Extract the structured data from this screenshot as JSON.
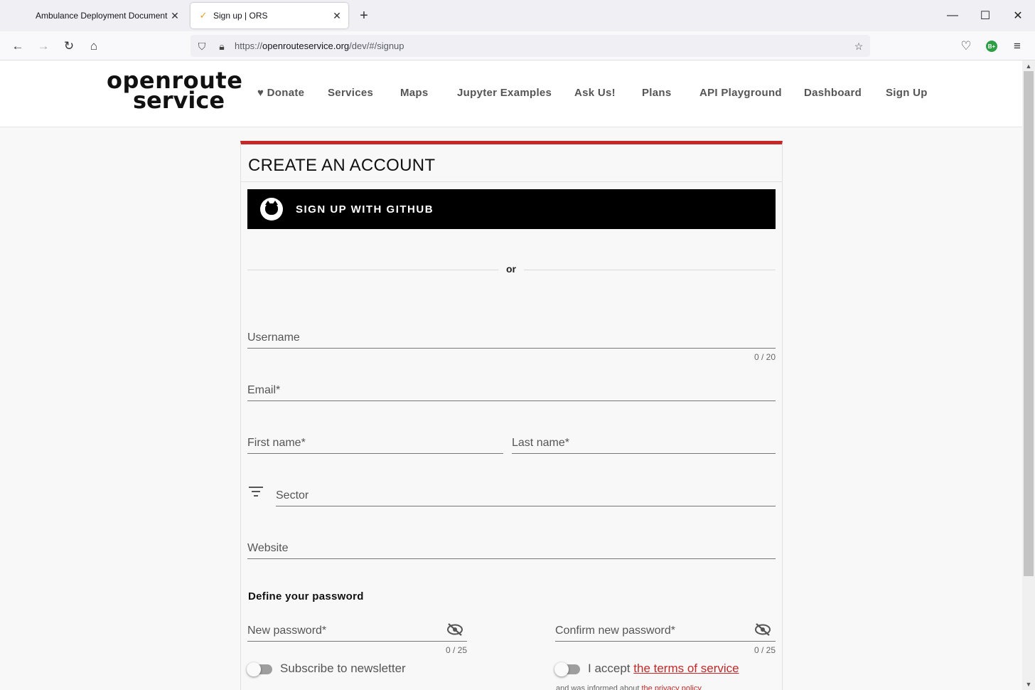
{
  "browser": {
    "tabs": [
      {
        "title": "Ambulance Deployment Document"
      },
      {
        "title": "Sign up | ORS"
      }
    ],
    "url_prefix": "https://",
    "url_domain": "openrouteservice.org",
    "url_path": "/dev/#/signup",
    "profile_badge": "B+"
  },
  "site": {
    "logo_line1": "openroute",
    "logo_line2": "service",
    "menu": [
      "♥ Donate",
      "Services",
      "Maps",
      "Jupyter Examples",
      "Ask Us!",
      "Plans",
      "API Playground",
      "Dashboard",
      "Sign Up"
    ]
  },
  "form": {
    "title": "CREATE AN ACCOUNT",
    "github_label": "SIGN UP WITH GITHUB",
    "or": "or",
    "username_label": "Username",
    "username_counter": "0 / 20",
    "email_label": "Email*",
    "first_name_label": "First name*",
    "last_name_label": "Last name*",
    "sector_label": "Sector",
    "website_label": "Website",
    "password_section": "Define your password",
    "new_password_label": "New password*",
    "new_password_counter": "0 / 25",
    "confirm_password_label": "Confirm new password*",
    "confirm_password_counter": "0 / 25",
    "newsletter_label": "Subscribe to newsletter",
    "terms_prefix": "I accept ",
    "terms_link": "the terms of service",
    "privacy_prefix": "and was informed about ",
    "privacy_link": "the privacy policy"
  },
  "colors": {
    "accent": "#c62828",
    "github_bg": "#000000"
  }
}
